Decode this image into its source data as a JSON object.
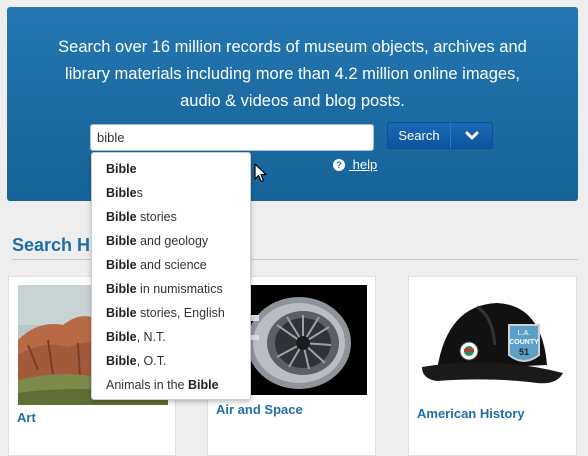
{
  "hero": {
    "line1": "Search over 16 million records of museum objects, archives and",
    "line2": "library materials including more than 4.2 million online images,",
    "line3": "audio & videos and blog posts."
  },
  "search": {
    "value": "bible",
    "button_label": "Search",
    "dropdown_icon": "chevron-down-icon"
  },
  "help": {
    "icon": "question-circle-icon",
    "label": " help"
  },
  "section": {
    "title": "Search H"
  },
  "cards": [
    {
      "label": "Art"
    },
    {
      "label": "Air and Space"
    },
    {
      "label": "American History"
    }
  ],
  "suggestions": [
    {
      "match": "Bible",
      "rest": ""
    },
    {
      "match": "Bible",
      "rest": "s"
    },
    {
      "match": "Bible",
      "rest": " stories"
    },
    {
      "match": "Bible",
      "rest": " and geology"
    },
    {
      "match": "Bible",
      "rest": " and science"
    },
    {
      "match": "Bible",
      "rest": " in numismatics"
    },
    {
      "match": "Bible",
      "rest": " stories, English"
    },
    {
      "match": "Bible",
      "rest": ", N.T."
    },
    {
      "match": "Bible",
      "rest": ", O.T."
    },
    {
      "pre": "Animals in the ",
      "match": "Bible",
      "rest": ""
    }
  ],
  "helmet": {
    "badge_line1": "L.A.",
    "badge_line2": "COUNTY",
    "badge_number": "51"
  },
  "colors": {
    "hero_bg": "#1f6fa6",
    "button_bg": "#0e54a0",
    "link": "#1f6fa6"
  }
}
